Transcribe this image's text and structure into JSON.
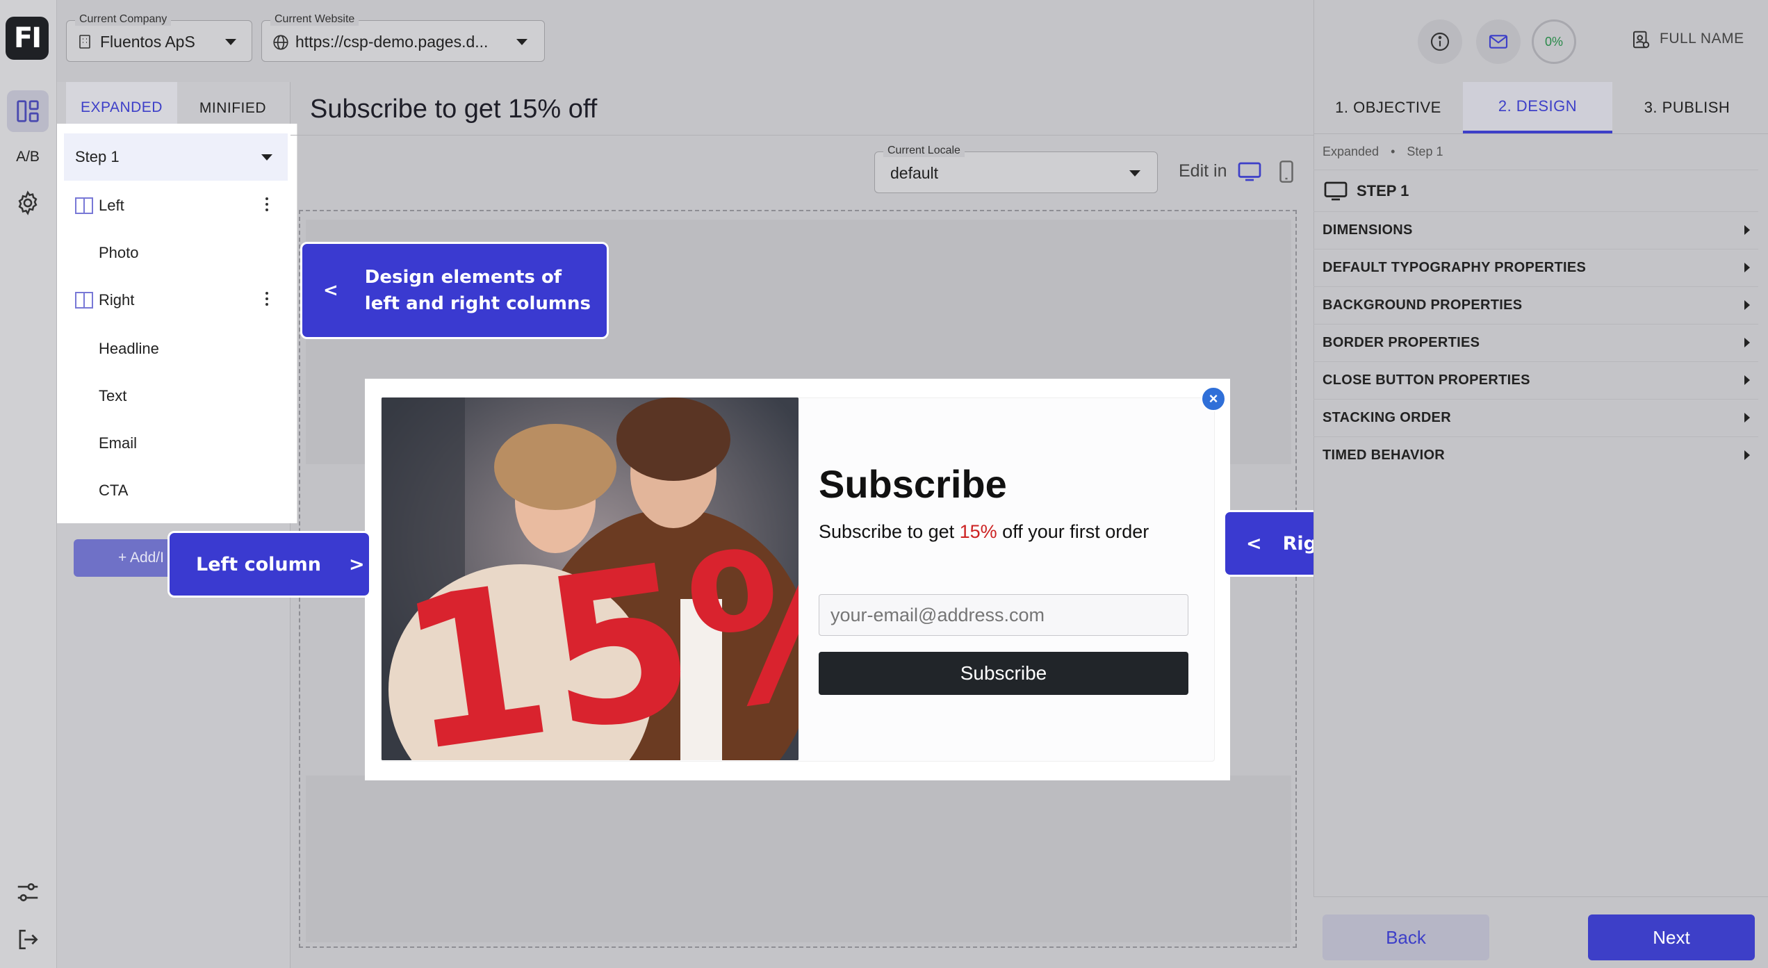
{
  "logo": {
    "text": "FI"
  },
  "rail": {
    "ab_label": "A/B"
  },
  "company": {
    "label": "Current Company",
    "value": "Fluentos ApS"
  },
  "website": {
    "label": "Current Website",
    "value": "https://csp-demo.pages.d..."
  },
  "left_tabs": {
    "expanded": "EXPANDED",
    "minified": "MINIFIED"
  },
  "tree": {
    "step": "Step 1",
    "items": [
      {
        "label": "Left"
      },
      {
        "label": "Photo"
      },
      {
        "label": "Right"
      },
      {
        "label": "Headline"
      },
      {
        "label": "Text"
      },
      {
        "label": "Email"
      },
      {
        "label": "CTA"
      }
    ]
  },
  "add_button": {
    "label": "+ Add/I"
  },
  "page_title": "Subscribe to get 15% off",
  "locale": {
    "label": "Current Locale",
    "value": "default"
  },
  "edit_in": "Edit in",
  "popup": {
    "headline": "Subscribe",
    "text_before": "Subscribe to get ",
    "text_highlight": "15%",
    "text_after": " off your first order",
    "email_placeholder": "your-email@address.com",
    "button": "Subscribe",
    "close_symbol": "×",
    "photo_digits": "15%"
  },
  "callouts": {
    "design_arrow": "<",
    "design_line1": "Design elements of",
    "design_line2": "left and right columns",
    "left": "Left column",
    "left_arrow": ">",
    "right_arrow": "<",
    "right": "Right column"
  },
  "header_right": {
    "progress": "0%",
    "user": "FULL NAME"
  },
  "right_tabs": [
    "1. OBJECTIVE",
    "2. DESIGN",
    "3. PUBLISH"
  ],
  "breadcrumb": {
    "part1": "Expanded",
    "sep": "•",
    "part2": "Step 1"
  },
  "step_header": "STEP 1",
  "properties": [
    "DIMENSIONS",
    "DEFAULT TYPOGRAPHY PROPERTIES",
    "BACKGROUND PROPERTIES",
    "BORDER PROPERTIES",
    "CLOSE BUTTON PROPERTIES",
    "STACKING ORDER",
    "TIMED BEHAVIOR"
  ],
  "footer": {
    "back": "Back",
    "next": "Next"
  },
  "colors": {
    "accent": "#3d3fc8",
    "callout": "#3a3ad0",
    "highlight": "#cc2222",
    "cta": "#212529"
  }
}
